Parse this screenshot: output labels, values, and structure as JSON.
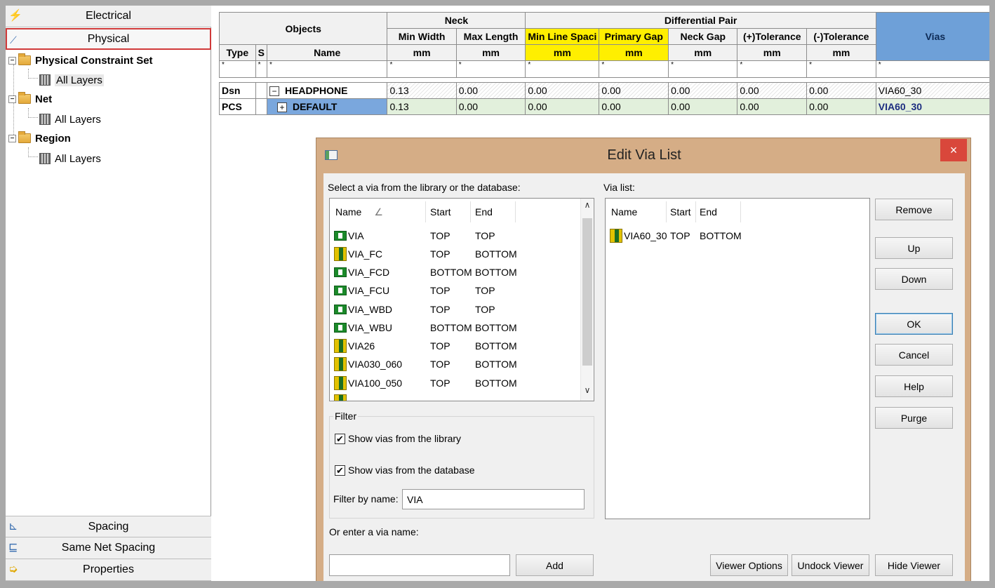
{
  "left_panel": {
    "categories_top": [
      {
        "label": "Electrical",
        "icon": "lightning-icon"
      },
      {
        "label": "Physical",
        "icon": "physical-icon"
      }
    ],
    "tree": {
      "physical_constraint_set": "Physical Constraint Set",
      "all_layers_1": "All Layers",
      "net": "Net",
      "all_layers_2": "All Layers",
      "region": "Region",
      "all_layers_3": "All Layers"
    },
    "categories_bottom": [
      {
        "label": "Spacing",
        "icon": "spacing-icon"
      },
      {
        "label": "Same Net Spacing",
        "icon": "same-net-spacing-icon"
      },
      {
        "label": "Properties",
        "icon": "properties-icon"
      }
    ]
  },
  "grid": {
    "objects": "Objects",
    "neck": "Neck",
    "differential_pair": "Differential Pair",
    "vias": "Vias",
    "min_width": "Min Width",
    "max_length": "Max Length",
    "min_line_spacing": "Min Line Spaci",
    "primary_gap": "Primary Gap",
    "neck_gap": "Neck Gap",
    "plus_tolerance": "(+)Tolerance",
    "minus_tolerance": "(-)Tolerance",
    "type": "Type",
    "s": "S",
    "name": "Name",
    "unit": "mm",
    "wildcard": "*",
    "rows": [
      {
        "type": "Dsn",
        "expander": "−",
        "name": "HEADPHONE",
        "min_width": "0.13",
        "max_length": "0.00",
        "min_line_spacing": "0.00",
        "primary_gap": "0.00",
        "neck_gap": "0.00",
        "plus_tol": "0.00",
        "minus_tol": "0.00",
        "vias": "VIA60_30"
      },
      {
        "type": "PCS",
        "expander": "+",
        "name": "DEFAULT",
        "min_width": "0.13",
        "max_length": "0.00",
        "min_line_spacing": "0.00",
        "primary_gap": "0.00",
        "neck_gap": "0.00",
        "plus_tol": "0.00",
        "minus_tol": "0.00",
        "vias": "VIA60_30"
      }
    ]
  },
  "dialog": {
    "title": "Edit Via List",
    "close": "×",
    "select_label": "Select a via from the library or the database:",
    "via_list_label": "Via list:",
    "lib_headers": {
      "name": "Name",
      "sort": "∠",
      "start": "Start",
      "end": "End"
    },
    "lib_rows": [
      {
        "name": "VIA",
        "start": "TOP",
        "end": "TOP",
        "icon": "green"
      },
      {
        "name": "VIA_FC",
        "start": "TOP",
        "end": "BOTTOM",
        "icon": "yellow"
      },
      {
        "name": "VIA_FCD",
        "start": "BOTTOM",
        "end": "BOTTOM",
        "icon": "green"
      },
      {
        "name": "VIA_FCU",
        "start": "TOP",
        "end": "TOP",
        "icon": "green"
      },
      {
        "name": "VIA_WBD",
        "start": "TOP",
        "end": "TOP",
        "icon": "green"
      },
      {
        "name": "VIA_WBU",
        "start": "BOTTOM",
        "end": "BOTTOM",
        "icon": "green"
      },
      {
        "name": "VIA26",
        "start": "TOP",
        "end": "BOTTOM",
        "icon": "yellow"
      },
      {
        "name": "VIA030_060",
        "start": "TOP",
        "end": "BOTTOM",
        "icon": "yellow"
      },
      {
        "name": "VIA100_050",
        "start": "TOP",
        "end": "BOTTOM",
        "icon": "yellow"
      }
    ],
    "vlist_headers": {
      "name": "Name",
      "start": "Start",
      "end": "End"
    },
    "vlist_rows": [
      {
        "name": "VIA60_30",
        "start": "TOP",
        "end": "BOTTOM"
      }
    ],
    "filter": {
      "title": "Filter",
      "show_library": "Show vias from the library",
      "show_database": "Show vias from the database",
      "show_library_checked": true,
      "show_database_checked": true,
      "filter_by_name_label": "Filter by name:",
      "filter_by_name_value": "VIA"
    },
    "or_enter_label": "Or enter a via name:",
    "via_name_value": "",
    "buttons": {
      "remove": "Remove",
      "up": "Up",
      "down": "Down",
      "ok": "OK",
      "cancel": "Cancel",
      "help": "Help",
      "purge": "Purge",
      "add": "Add",
      "viewer_options": "Viewer Options",
      "undock_viewer": "Undock Viewer",
      "hide_viewer": "Hide Viewer"
    },
    "check_mark": "✔"
  }
}
